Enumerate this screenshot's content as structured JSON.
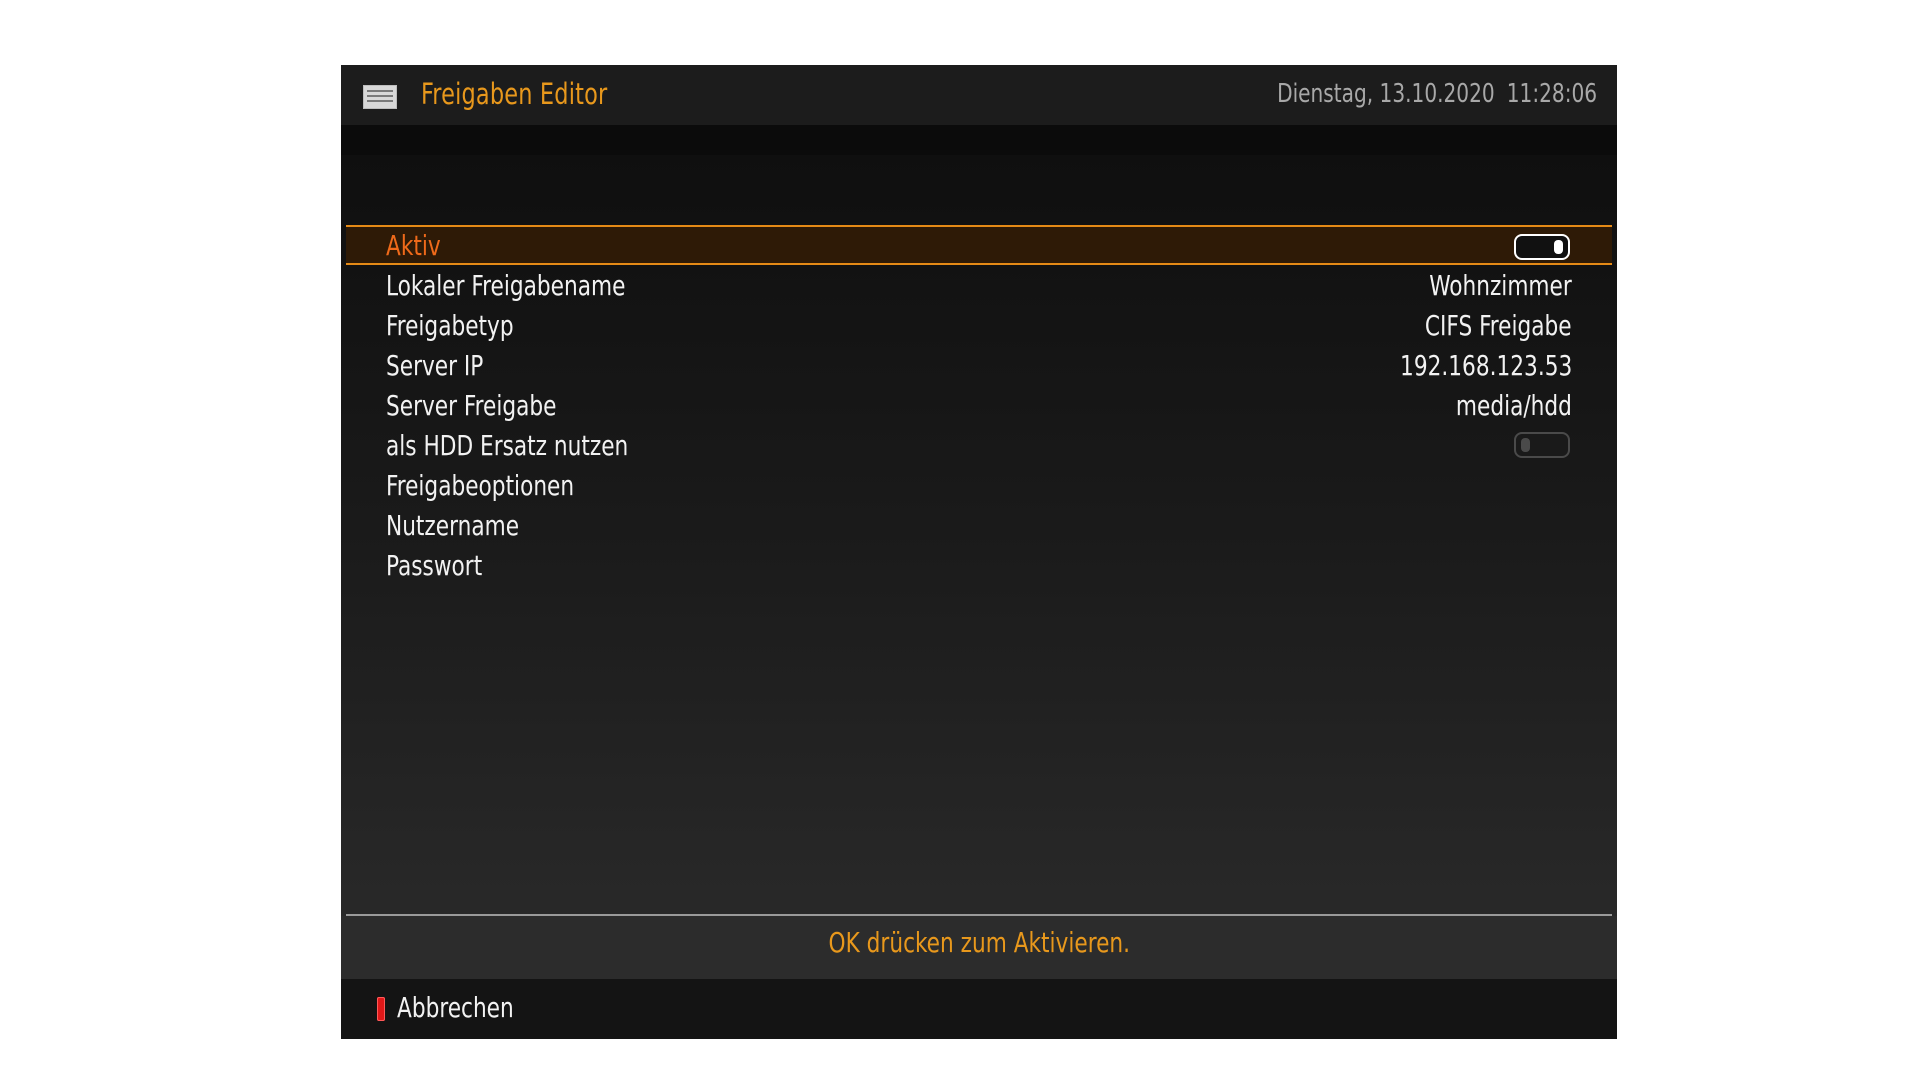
{
  "header": {
    "title": "Freigaben Editor",
    "date": "Dienstag, 13.10.2020",
    "time": "11:28:06",
    "icon": "screen-icon"
  },
  "settings": [
    {
      "label": "Aktiv",
      "type": "toggle",
      "state": "on",
      "selected": true
    },
    {
      "label": "Lokaler Freigabename",
      "type": "text",
      "value": "Wohnzimmer"
    },
    {
      "label": "Freigabetyp",
      "type": "text",
      "value": "CIFS Freigabe"
    },
    {
      "label": "Server IP",
      "type": "text",
      "value": "192.168.123.53"
    },
    {
      "label": "Server Freigabe",
      "type": "text",
      "value": "media/hdd"
    },
    {
      "label": "als HDD Ersatz nutzen",
      "type": "toggle",
      "state": "off"
    },
    {
      "label": "Freigabeoptionen",
      "type": "text",
      "value": ""
    },
    {
      "label": "Nutzername",
      "type": "text",
      "value": ""
    },
    {
      "label": "Passwort",
      "type": "text",
      "value": ""
    }
  ],
  "hint": "OK drücken zum Aktivieren.",
  "footer": {
    "red_button_label": "Abbrechen",
    "red_button_color": "#e01818"
  },
  "colors": {
    "accent": "#e8981c",
    "selection_border": "#e58a16",
    "selected_label": "#ef6a1a"
  }
}
